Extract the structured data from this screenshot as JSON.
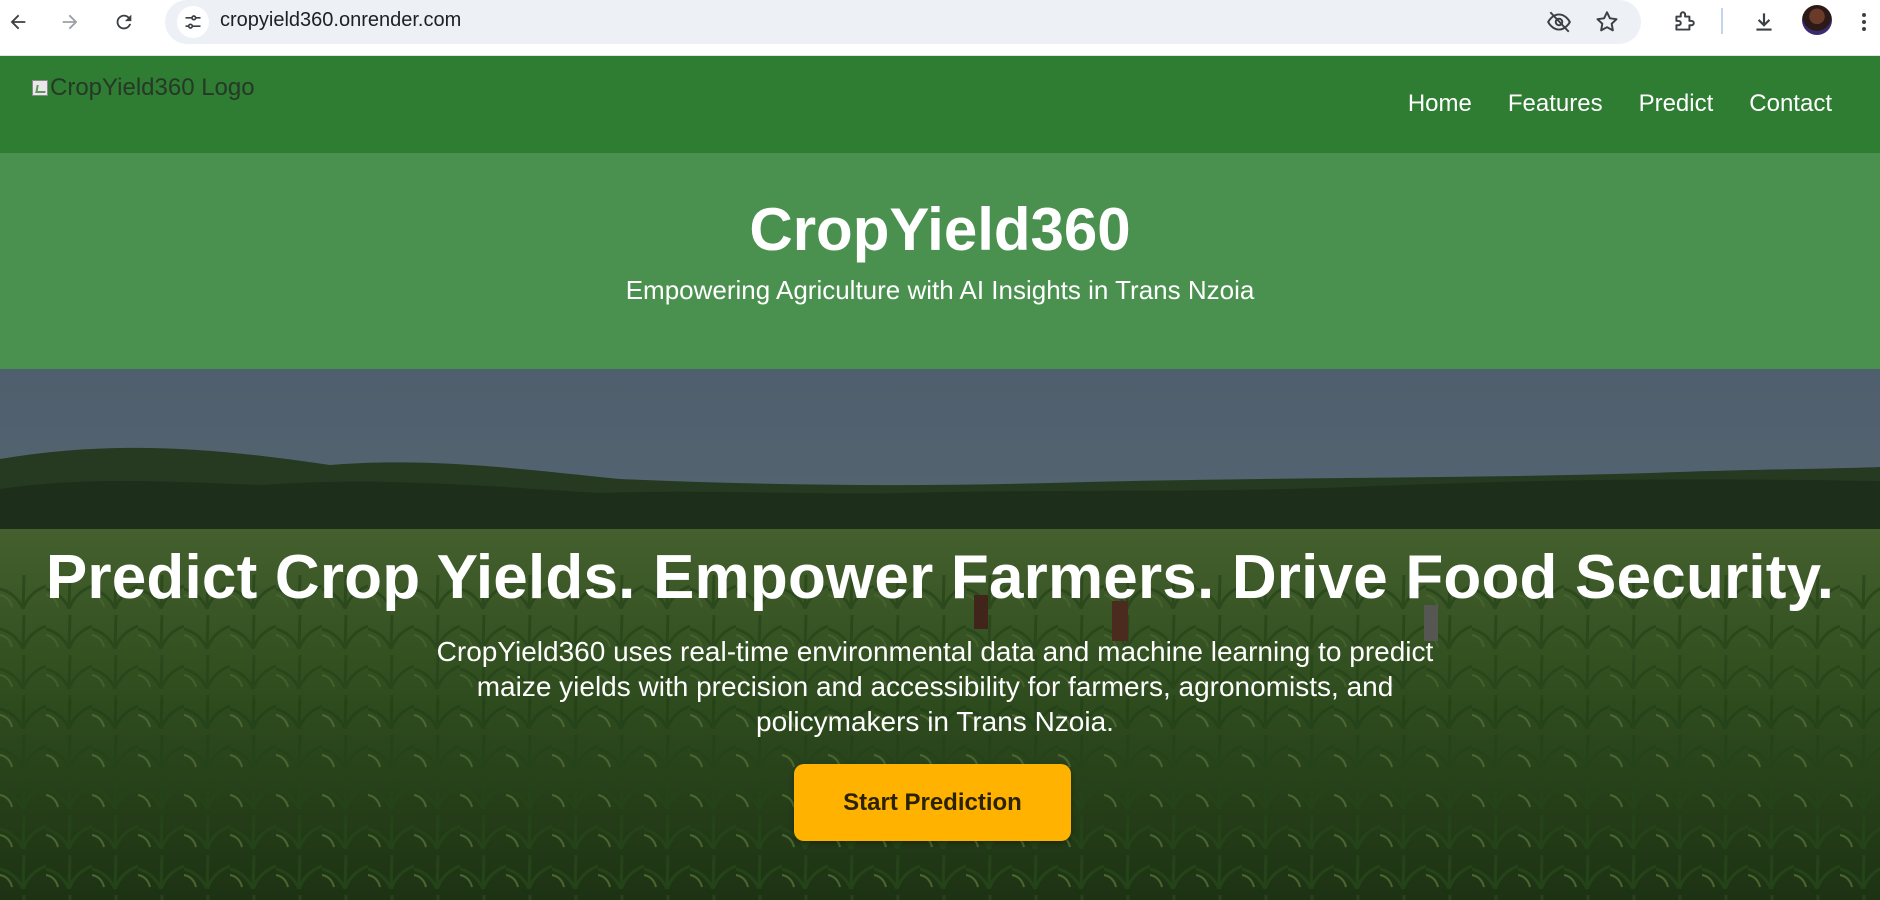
{
  "browser": {
    "url": "cropyield360.onrender.com",
    "icons": {
      "back": "arrow-left",
      "forward": "arrow-right",
      "reload": "reload",
      "site_info": "tune",
      "tracking": "eye-off",
      "bookmark": "star-outline",
      "extensions": "puzzle",
      "downloads": "download",
      "profile": "avatar",
      "menu": "kebab"
    }
  },
  "header": {
    "logo_alt": "CropYield360 Logo",
    "nav": [
      "Home",
      "Features",
      "Predict",
      "Contact"
    ],
    "bg_color": "#2e7d32"
  },
  "banner": {
    "title": "CropYield360",
    "tagline": "Empowering Agriculture with AI Insights in Trans Nzoia",
    "bg_color": "#4a9150"
  },
  "hero": {
    "heading": "Predict Crop Yields. Empower Farmers. Drive Food Security.",
    "description": "CropYield360 uses real-time environmental data and machine learning to predict maize yields with precision and accessibility for farmers, agronomists, and policymakers in Trans Nzoia.",
    "cta_label": "Start Prediction",
    "cta_color": "#ffb300"
  }
}
